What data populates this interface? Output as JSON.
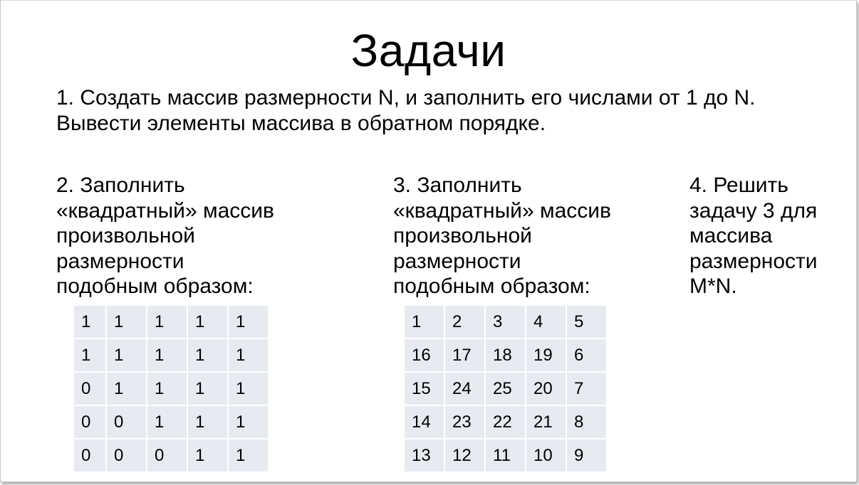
{
  "title": "Задачи",
  "task1": {
    "lines": [
      "1. Создать массив размерности N, и заполнить его числами от 1 до N.",
      "Вывести элементы массива в обратном порядке."
    ]
  },
  "task2": {
    "lines": [
      "2. Заполнить",
      "«квадратный» массив",
      "произвольной",
      "размерности",
      "подобным образом:"
    ],
    "grid": [
      [
        "1",
        "1",
        "1",
        "1",
        "1"
      ],
      [
        "1",
        "1",
        "1",
        "1",
        "1"
      ],
      [
        "0",
        "1",
        "1",
        "1",
        "1"
      ],
      [
        "0",
        "0",
        "1",
        "1",
        "1"
      ],
      [
        "0",
        "0",
        "0",
        "1",
        "1"
      ]
    ]
  },
  "task3": {
    "lines": [
      "3. Заполнить",
      "«квадратный» массив",
      "произвольной",
      "размерности",
      "подобным образом:"
    ],
    "grid": [
      [
        "1",
        "2",
        "3",
        "4",
        "5"
      ],
      [
        "16",
        "17",
        "18",
        "19",
        "6"
      ],
      [
        "15",
        "24",
        "25",
        "20",
        "7"
      ],
      [
        "14",
        "23",
        "22",
        "21",
        "8"
      ],
      [
        "13",
        "12",
        "11",
        "10",
        "9"
      ]
    ]
  },
  "task4": {
    "lines": [
      "4. Решить",
      "задачу 3 для",
      "массива",
      "размерности",
      "M*N."
    ]
  },
  "colors": {
    "cell_background": "#e7eaf1",
    "slide_border": "#c8c8c8"
  }
}
